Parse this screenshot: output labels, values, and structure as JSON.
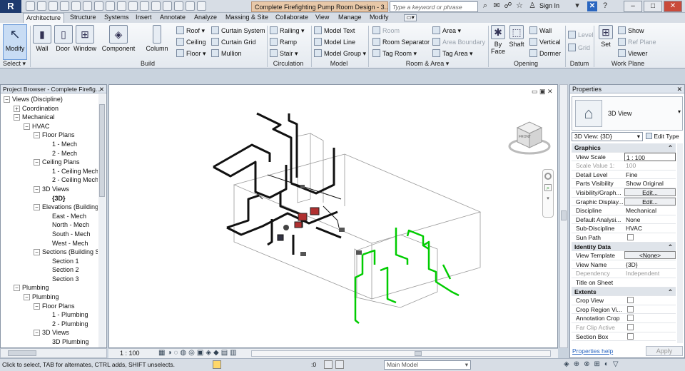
{
  "titlebar": {
    "logo": "R",
    "doc_title": "Complete Firefighting Pump Room Design - 3...",
    "search_placeholder": "Type a keyword or phrase",
    "signin": "Sign In",
    "help": "?",
    "min": "–",
    "max": "□",
    "close": "✕"
  },
  "tabs": [
    "Architecture",
    "Structure",
    "Systems",
    "Insert",
    "Annotate",
    "Analyze",
    "Massing & Site",
    "Collaborate",
    "View",
    "Manage",
    "Modify"
  ],
  "ribbon": {
    "modify": "Modify",
    "wall": "Wall",
    "door": "Door",
    "window": "Window",
    "component": "Component",
    "column": "Column",
    "roof": "Roof",
    "ceiling": "Ceiling",
    "floor": "Floor",
    "curtain_system": "Curtain System",
    "curtain_grid": "Curtain Grid",
    "mullion": "Mullion",
    "railing": "Railing",
    "ramp": "Ramp",
    "stair": "Stair",
    "model_text": "Model Text",
    "model_line": "Model Line",
    "model_group": "Model Group",
    "room": "Room",
    "room_separator": "Room Separator",
    "tag_room": "Tag Room",
    "area": "Area",
    "area_boundary": "Area Boundary",
    "tag_area": "Tag Area",
    "by_face": "By Face",
    "shaft": "Shaft",
    "wall_opening": "Wall",
    "vertical": "Vertical",
    "dormer": "Dormer",
    "level": "Level",
    "grid": "Grid",
    "set": "Set",
    "show": "Show",
    "ref_plane": "Ref Plane",
    "viewer": "Viewer",
    "panels": {
      "select": "Select",
      "build": "Build",
      "circulation": "Circulation",
      "model": "Model",
      "room_area": "Room & Area",
      "opening": "Opening",
      "datum": "Datum",
      "work_plane": "Work Plane"
    }
  },
  "project_browser": {
    "title": "Project Browser - Complete Firefig...",
    "items": [
      {
        "label": "Views (Discipline)",
        "level": 0,
        "tw": "−"
      },
      {
        "label": "Coordination",
        "level": 1,
        "tw": "+"
      },
      {
        "label": "Mechanical",
        "level": 1,
        "tw": "−"
      },
      {
        "label": "HVAC",
        "level": 2,
        "tw": "−"
      },
      {
        "label": "Floor Plans",
        "level": 3,
        "tw": "−"
      },
      {
        "label": "1 - Mech",
        "level": 4,
        "tw": ""
      },
      {
        "label": "2 - Mech",
        "level": 4,
        "tw": ""
      },
      {
        "label": "Ceiling Plans",
        "level": 3,
        "tw": "−"
      },
      {
        "label": "1 - Ceiling Mech",
        "level": 4,
        "tw": ""
      },
      {
        "label": "2 - Ceiling Mech",
        "level": 4,
        "tw": ""
      },
      {
        "label": "3D Views",
        "level": 3,
        "tw": "−"
      },
      {
        "label": "{3D}",
        "level": 4,
        "tw": "",
        "bold": true
      },
      {
        "label": "Elevations (Building",
        "level": 3,
        "tw": "−"
      },
      {
        "label": "East - Mech",
        "level": 4,
        "tw": ""
      },
      {
        "label": "North - Mech",
        "level": 4,
        "tw": ""
      },
      {
        "label": "South - Mech",
        "level": 4,
        "tw": ""
      },
      {
        "label": "West - Mech",
        "level": 4,
        "tw": ""
      },
      {
        "label": "Sections (Building S",
        "level": 3,
        "tw": "−"
      },
      {
        "label": "Section 1",
        "level": 4,
        "tw": ""
      },
      {
        "label": "Section 2",
        "level": 4,
        "tw": ""
      },
      {
        "label": "Section 3",
        "level": 4,
        "tw": ""
      },
      {
        "label": "Plumbing",
        "level": 1,
        "tw": "−"
      },
      {
        "label": "Plumbing",
        "level": 2,
        "tw": "−"
      },
      {
        "label": "Floor Plans",
        "level": 3,
        "tw": "−"
      },
      {
        "label": "1 - Plumbing",
        "level": 4,
        "tw": ""
      },
      {
        "label": "2 - Plumbing",
        "level": 4,
        "tw": ""
      },
      {
        "label": "3D Views",
        "level": 3,
        "tw": "−"
      },
      {
        "label": "3D Plumbing",
        "level": 4,
        "tw": ""
      }
    ]
  },
  "viewcube": {
    "front": "FRONT"
  },
  "view_bar": {
    "scale": "1 : 100"
  },
  "properties": {
    "title": "Properties",
    "type_name": "3D View",
    "selector": "3D View: {3D}",
    "edit_type": "Edit Type",
    "rows": [
      {
        "group": "Graphics"
      },
      {
        "k": "View Scale",
        "v": "1 : 100",
        "input": true
      },
      {
        "k": "Scale Value    1:",
        "v": "100",
        "dis": true
      },
      {
        "k": "Detail Level",
        "v": "Fine"
      },
      {
        "k": "Parts Visibility",
        "v": "Show Original"
      },
      {
        "k": "Visibility/Graph...",
        "btn": "Edit..."
      },
      {
        "k": "Graphic Display...",
        "btn": "Edit..."
      },
      {
        "k": "Discipline",
        "v": "Mechanical"
      },
      {
        "k": "Default Analysi...",
        "v": "None"
      },
      {
        "k": "Sub-Discipline",
        "v": "HVAC"
      },
      {
        "k": "Sun Path",
        "chk": true
      },
      {
        "group": "Identity Data"
      },
      {
        "k": "View Template",
        "btn": "<None>"
      },
      {
        "k": "View Name",
        "v": "{3D}"
      },
      {
        "k": "Dependency",
        "v": "Independent",
        "dis": true
      },
      {
        "k": "Title on Sheet",
        "v": ""
      },
      {
        "group": "Extents"
      },
      {
        "k": "Crop View",
        "chk": true
      },
      {
        "k": "Crop Region Vi...",
        "chk": true
      },
      {
        "k": "Annotation Crop",
        "chk": true
      },
      {
        "k": "Far Clip Active",
        "chk": true,
        "dis": true
      },
      {
        "k": "Section Box",
        "chk": true
      }
    ],
    "help_link": "Properties help",
    "apply": "Apply"
  },
  "status": {
    "message": "Click to select, TAB for alternates, CTRL adds, SHIFT unselects.",
    "zero": ":0",
    "model": "Main Model"
  },
  "colors": {
    "pipe": "#111111",
    "green": "#00cc00",
    "accent": "#2a66c0"
  }
}
